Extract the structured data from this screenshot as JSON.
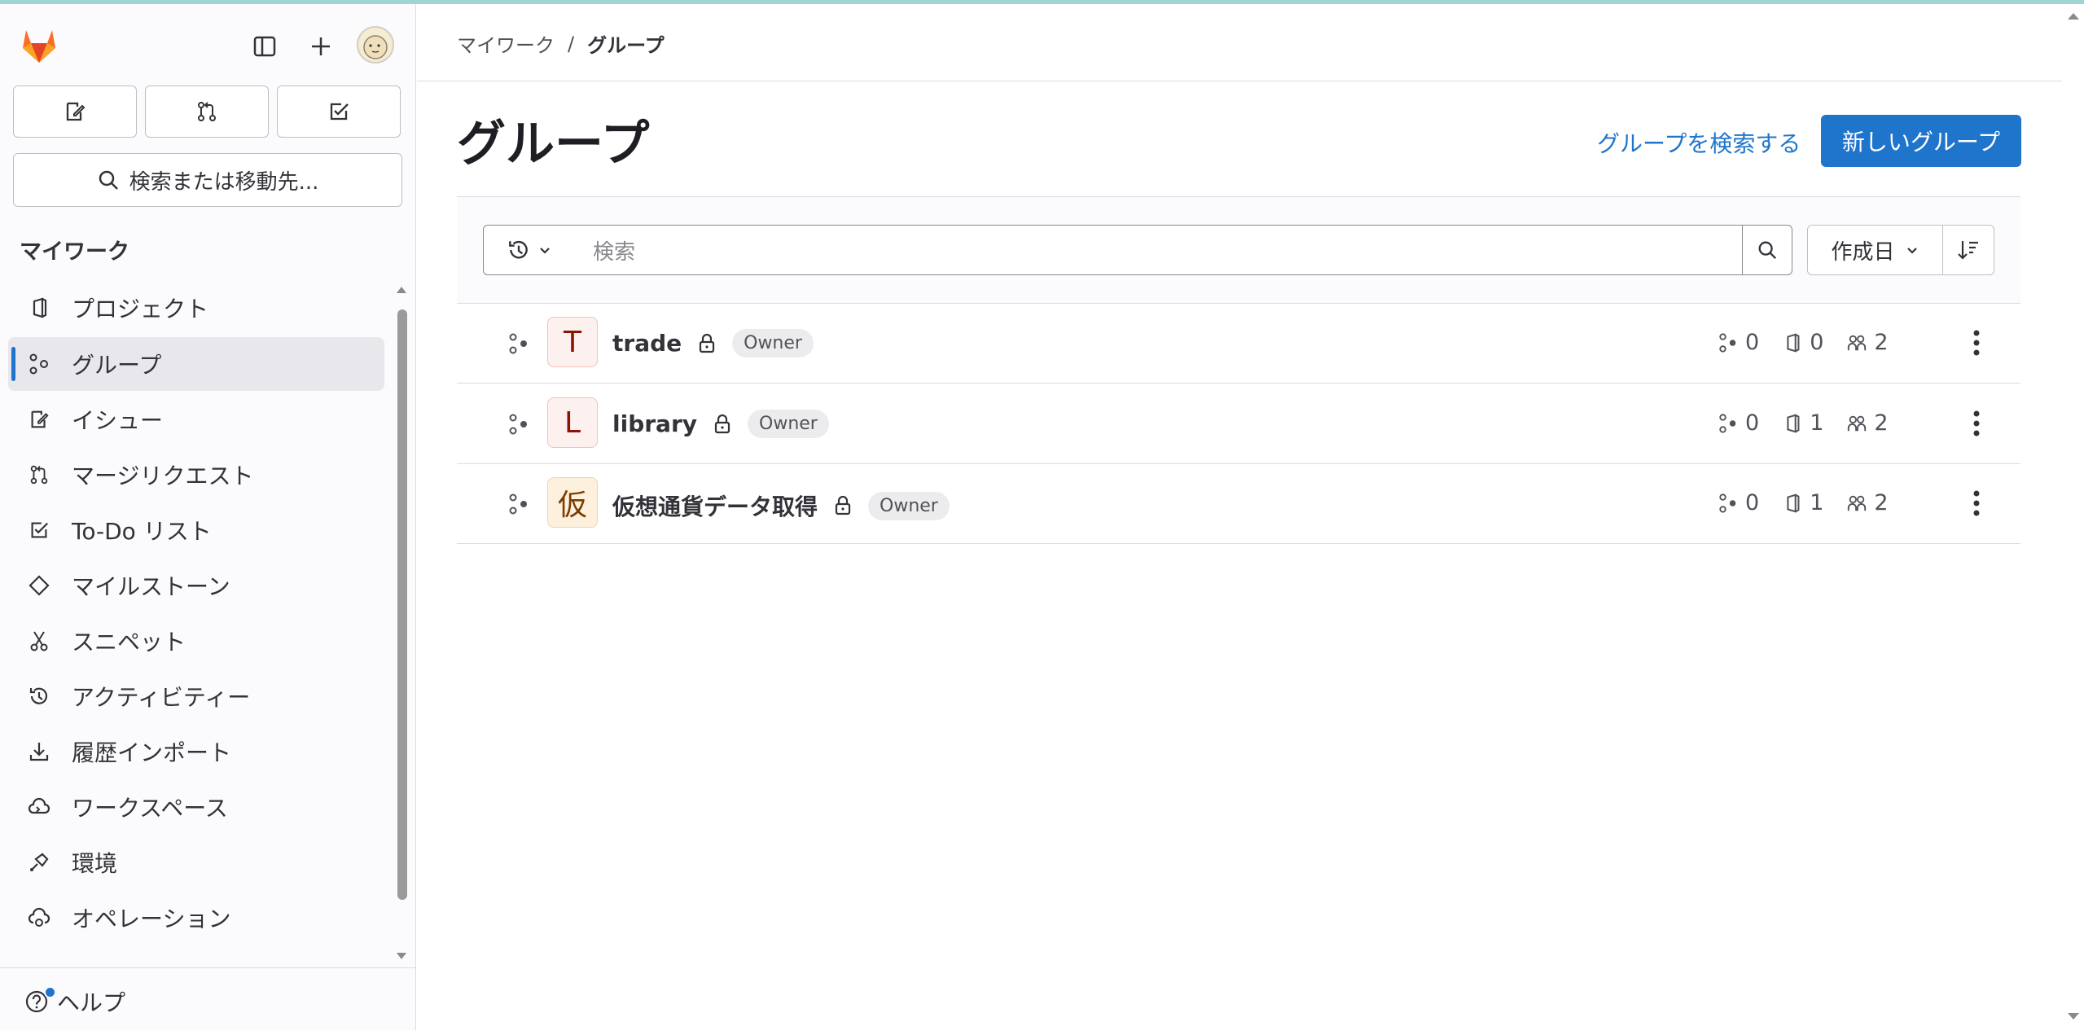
{
  "sidebar": {
    "search_label": "検索または移動先...",
    "section_label": "マイワーク",
    "items": [
      {
        "label": "プロジェクト",
        "icon": "project-icon"
      },
      {
        "label": "グループ",
        "icon": "group-icon",
        "active": true
      },
      {
        "label": "イシュー",
        "icon": "issue-icon"
      },
      {
        "label": "マージリクエスト",
        "icon": "merge-request-icon"
      },
      {
        "label": "To-Do リスト",
        "icon": "todo-icon"
      },
      {
        "label": "マイルストーン",
        "icon": "milestone-icon"
      },
      {
        "label": "スニペット",
        "icon": "snippet-icon"
      },
      {
        "label": "アクティビティー",
        "icon": "history-icon"
      },
      {
        "label": "履歴インポート",
        "icon": "import-icon"
      },
      {
        "label": "ワークスペース",
        "icon": "workspace-icon"
      },
      {
        "label": "環境",
        "icon": "environment-icon"
      },
      {
        "label": "オペレーション",
        "icon": "operations-icon"
      }
    ],
    "help_label": "ヘルプ"
  },
  "breadcrumb": {
    "parent": "マイワーク",
    "separator": "/",
    "current": "グループ"
  },
  "header": {
    "title": "グループ",
    "explore_link": "グループを検索する",
    "new_button": "新しいグループ"
  },
  "filter": {
    "search_placeholder": "検索",
    "sort_label": "作成日"
  },
  "groups": [
    {
      "avatar_letter": "T",
      "name": "trade",
      "role": "Owner",
      "subgroups": "0",
      "projects": "0",
      "members": "2",
      "avatar_bg": "#fcf1ef",
      "avatar_fg": "#8d1300",
      "avatar_border": "#f5c1b6"
    },
    {
      "avatar_letter": "L",
      "name": "library",
      "role": "Owner",
      "subgroups": "0",
      "projects": "1",
      "members": "2",
      "avatar_bg": "#fcf1ef",
      "avatar_fg": "#8d1300",
      "avatar_border": "#f5c1b6"
    },
    {
      "avatar_letter": "仮",
      "name": "仮想通貨データ取得",
      "role": "Owner",
      "subgroups": "0",
      "projects": "1",
      "members": "2",
      "avatar_bg": "#fdf1dd",
      "avatar_fg": "#7a3c00",
      "avatar_border": "#f3d4a4"
    }
  ],
  "colors": {
    "accent": "#1f75cb",
    "sidebar_bg": "#fbfafd",
    "logo_orange": "#fc6d26"
  }
}
